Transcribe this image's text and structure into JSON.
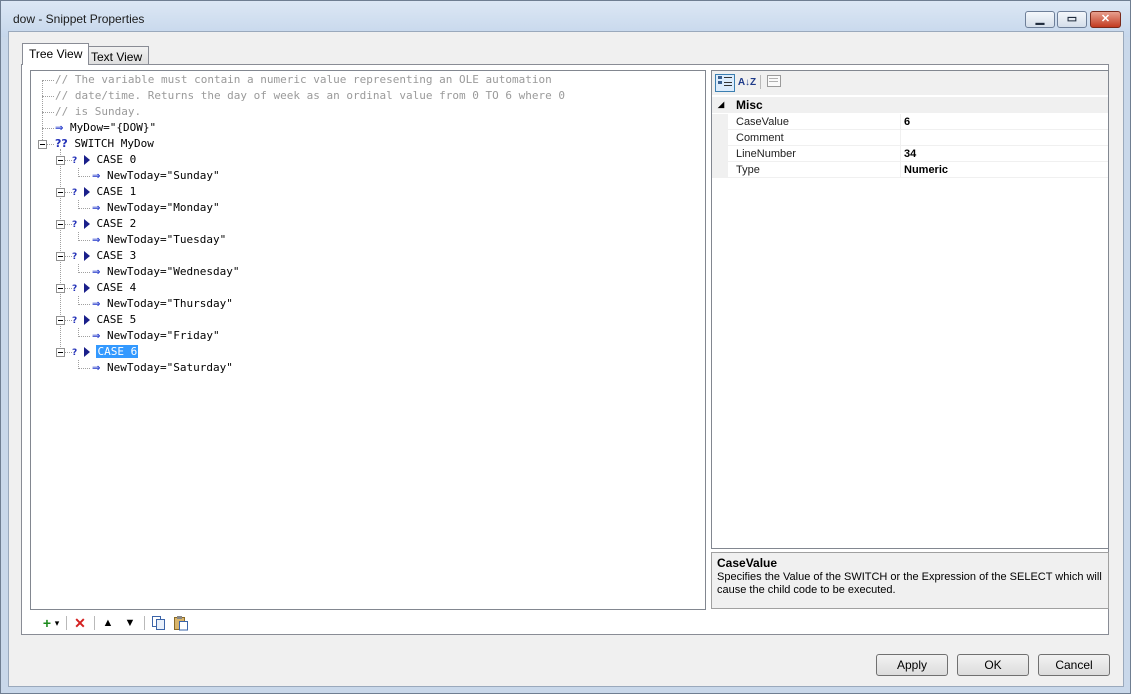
{
  "window": {
    "title": "dow - Snippet Properties",
    "min_glyph": "▁",
    "max_glyph": "▭",
    "close_glyph": "✕"
  },
  "tabs": [
    {
      "label": "Tree View"
    },
    {
      "label": "Text View"
    }
  ],
  "tree": {
    "comment_lines": [
      "// The variable must contain a numeric value representing an OLE automation",
      "// date/time. Returns the day of week as an ordinal value from 0 TO 6 where 0",
      "// is Sunday."
    ],
    "assign": "MyDow=\"{DOW}\"",
    "switch_icon": "??",
    "switch": "SWITCH MyDow",
    "cases": [
      {
        "label": "CASE 0",
        "child": "NewToday=\"Sunday\""
      },
      {
        "label": "CASE 1",
        "child": "NewToday=\"Monday\""
      },
      {
        "label": "CASE 2",
        "child": "NewToday=\"Tuesday\""
      },
      {
        "label": "CASE 3",
        "child": "NewToday=\"Wednesday\""
      },
      {
        "label": "CASE 4",
        "child": "NewToday=\"Thursday\""
      },
      {
        "label": "CASE 5",
        "child": "NewToday=\"Friday\""
      },
      {
        "label": "CASE 6",
        "child": "NewToday=\"Saturday\"",
        "selected": true
      }
    ],
    "q_mark": "?",
    "arrow_glyph": "⇒"
  },
  "property_grid": {
    "toolbar": {
      "categorized_icon": "categorized-icon",
      "alphabetical_label": "A↓Z",
      "pages_icon": "property-pages-icon"
    },
    "category": {
      "expand_glyph": "◢",
      "name": "Misc"
    },
    "rows": [
      {
        "name": "CaseValue",
        "value": "6"
      },
      {
        "name": "Comment",
        "value": ""
      },
      {
        "name": "LineNumber",
        "value": "34"
      },
      {
        "name": "Type",
        "value": "Numeric"
      }
    ],
    "description": {
      "title": "CaseValue",
      "text": "Specifies the Value of the SWITCH or the Expression of the SELECT which will cause the child code to be executed."
    }
  },
  "bottom_toolbar": {
    "add": "+",
    "add_dropdown": "▾",
    "delete": "✕",
    "move_up": "▲",
    "move_down": "▼",
    "copy_icon": "copy-icon",
    "paste_icon": "paste-icon"
  },
  "buttons": {
    "apply": "Apply",
    "ok": "OK",
    "cancel": "Cancel"
  },
  "colors": {
    "selection": "#3399ff",
    "arrow": "#1f35c9",
    "comment": "#9a9a9a",
    "delete": "#d42020",
    "add": "#1c8a1c"
  }
}
